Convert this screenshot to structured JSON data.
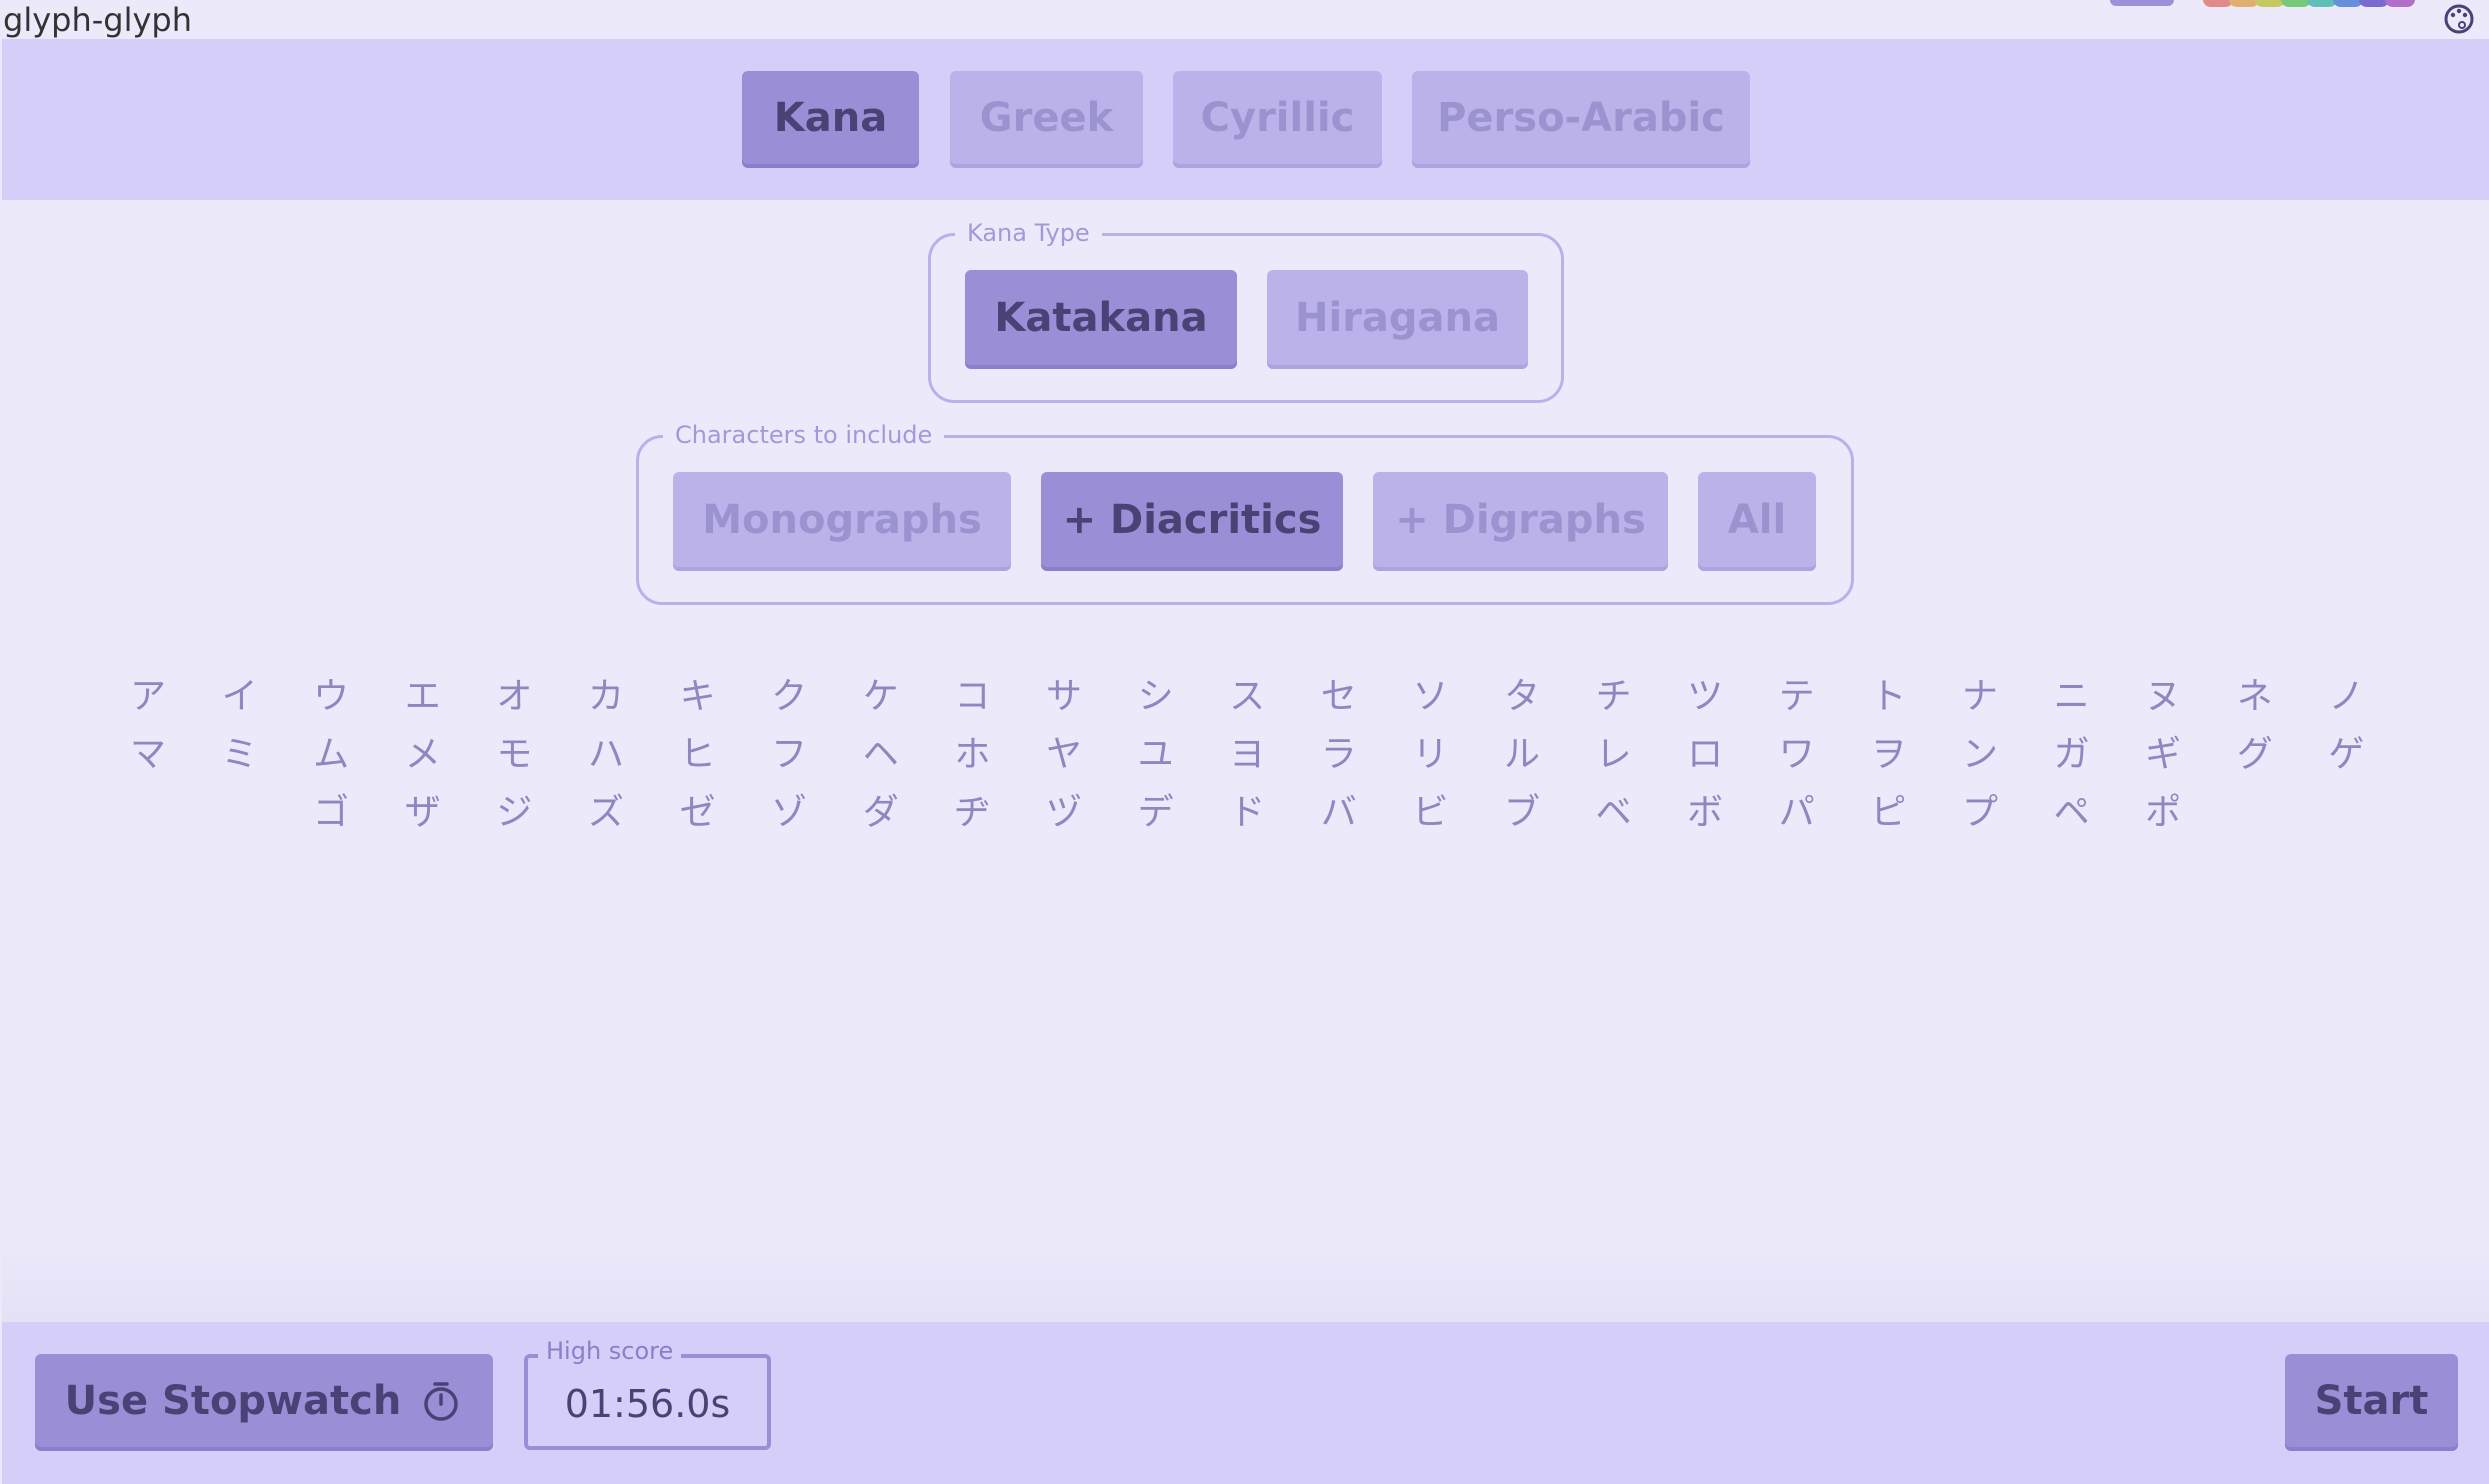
{
  "app": {
    "title": "glyph-glyph"
  },
  "icons": {
    "theme": "palette-icon",
    "timer": "stopwatch-icon"
  },
  "colors": {
    "accent": "#9a8fd7",
    "background": "#ece9fb",
    "bar": "#d5cef8",
    "swatches": [
      "#e08a8a",
      "#e0b070",
      "#c8c860",
      "#78c878",
      "#60c0b8",
      "#6890d8",
      "#7a6ad0",
      "#b070c8"
    ]
  },
  "scripts": {
    "tabs": [
      {
        "label": "Kana",
        "active": true
      },
      {
        "label": "Greek",
        "active": false
      },
      {
        "label": "Cyrillic",
        "active": false
      },
      {
        "label": "Perso-Arabic",
        "active": false
      }
    ]
  },
  "kana_type": {
    "legend": "Kana Type",
    "options": [
      {
        "label": "Katakana",
        "active": true
      },
      {
        "label": "Hiragana",
        "active": false
      }
    ]
  },
  "characters": {
    "legend": "Characters to include",
    "options": [
      {
        "label": "Monographs",
        "active": false
      },
      {
        "label": "+ Diacritics",
        "active": true
      },
      {
        "label": "+ Digraphs",
        "active": false
      },
      {
        "label": "All",
        "active": false
      }
    ]
  },
  "glyph_rows": [
    [
      "ア",
      "イ",
      "ウ",
      "エ",
      "オ",
      "カ",
      "キ",
      "ク",
      "ケ",
      "コ",
      "サ",
      "シ",
      "ス",
      "セ",
      "ソ",
      "タ",
      "チ",
      "ツ",
      "テ",
      "ト",
      "ナ",
      "ニ",
      "ヌ",
      "ネ",
      "ノ"
    ],
    [
      "マ",
      "ミ",
      "ム",
      "メ",
      "モ",
      "ハ",
      "ヒ",
      "フ",
      "ヘ",
      "ホ",
      "ヤ",
      "ユ",
      "ヨ",
      "ラ",
      "リ",
      "ル",
      "レ",
      "ロ",
      "ワ",
      "ヲ",
      "ン",
      "ガ",
      "ギ",
      "グ",
      "ゲ"
    ],
    [
      "ゴ",
      "ザ",
      "ジ",
      "ズ",
      "ゼ",
      "ゾ",
      "ダ",
      "ヂ",
      "ヅ",
      "デ",
      "ド",
      "バ",
      "ビ",
      "ブ",
      "ベ",
      "ボ",
      "パ",
      "ピ",
      "プ",
      "ペ",
      "ポ"
    ]
  ],
  "footer": {
    "stopwatch_label": "Use Stopwatch",
    "high_score_label": "High score",
    "high_score_value": "01:56.0s",
    "start_label": "Start"
  }
}
